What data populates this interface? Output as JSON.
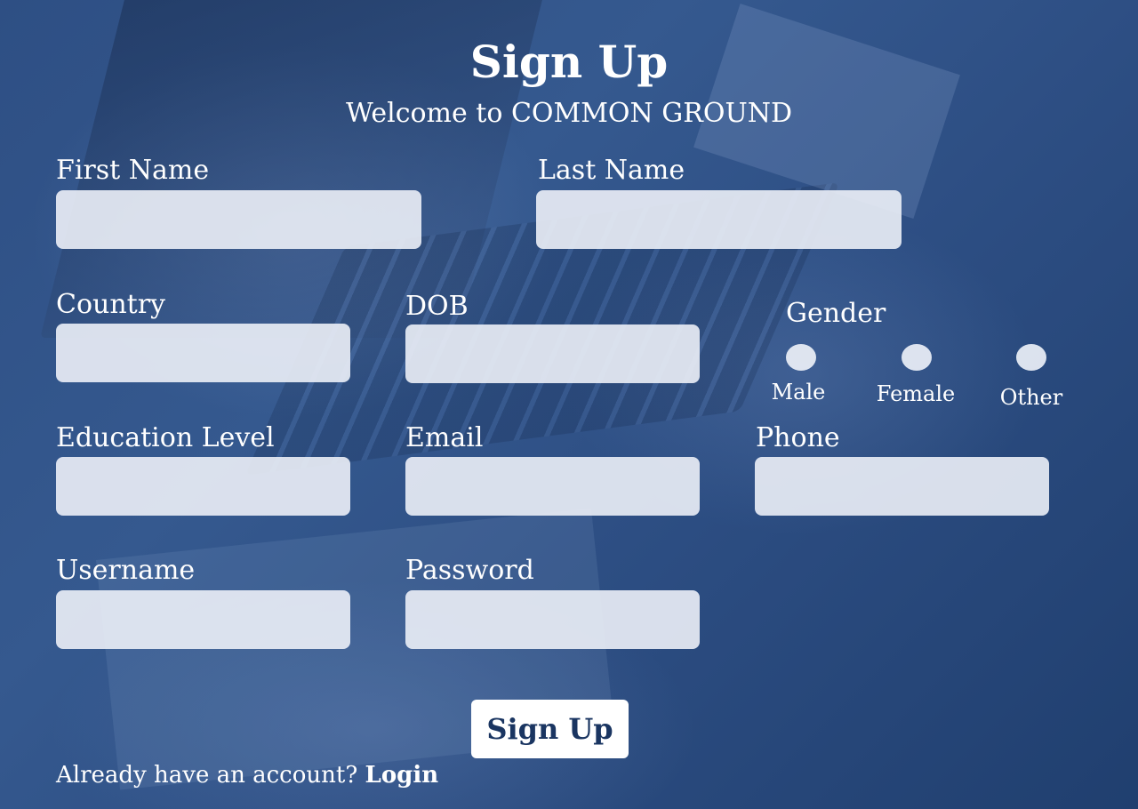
{
  "header": {
    "title": "Sign Up",
    "subtitle": "Welcome to COMMON GROUND"
  },
  "fields": {
    "first_name": {
      "label": "First Name",
      "value": "",
      "placeholder": ""
    },
    "last_name": {
      "label": "Last Name",
      "value": "",
      "placeholder": ""
    },
    "country": {
      "label": "Country",
      "value": "",
      "placeholder": ""
    },
    "dob": {
      "label": "DOB",
      "value": "",
      "placeholder": ""
    },
    "education_level": {
      "label": "Education Level",
      "value": "",
      "placeholder": ""
    },
    "email": {
      "label": "Email",
      "value": "",
      "placeholder": ""
    },
    "phone": {
      "label": "Phone",
      "value": "",
      "placeholder": ""
    },
    "username": {
      "label": "Username",
      "value": "",
      "placeholder": ""
    },
    "password": {
      "label": "Password",
      "value": "",
      "placeholder": ""
    }
  },
  "gender": {
    "label": "Gender",
    "options": [
      "Male",
      "Female",
      "Other"
    ],
    "selected": null
  },
  "actions": {
    "submit_label": "Sign Up"
  },
  "footer": {
    "prompt": "Already have an account?",
    "login_label": "Login"
  },
  "colors": {
    "background": "#2e4f84",
    "input_fill": "#ecf0f7",
    "button_fill": "#ffffff",
    "button_text": "#1a3561",
    "text": "#ffffff"
  }
}
